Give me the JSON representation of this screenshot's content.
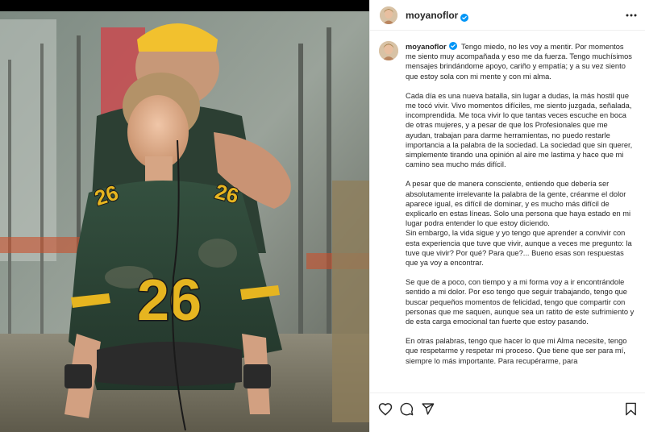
{
  "post": {
    "username": "moyanoflor",
    "verified": true,
    "more_icon": "more-horizontal-icon"
  },
  "photo": {
    "description_icon": "post-photo",
    "jersey_number": "26",
    "sleeve_number": "26"
  },
  "caption": {
    "username": "moyanoflor",
    "paragraphs": [
      "Tengo miedo, no les voy a mentir. Por momentos me siento muy acompañada y eso me da fuerza. Tengo muchísimos mensajes brindándome apoyo, cariño y empatía; y a su vez siento que estoy sola con mi mente y con mi alma.",
      "Cada día es una nueva batalla, sin lugar a dudas, la más hostil que me tocó vivir. Vivo momentos difíciles, me siento juzgada, señalada, incomprendida. Me toca vivir lo que tantas veces escuche en boca de otras mujeres, y a pesar de que los Profesionales que me ayudan, trabajan para darme herramientas, no puedo restarle importancia a la palabra de la sociedad. La sociedad que sin querer, simplemente tirando una opinión al aire me lastima y hace que mi camino sea mucho más difícil.",
      "A pesar que de manera consciente, entiendo que debería ser absolutamente irrelevante la palabra de la gente, créanme el dolor aparece igual, es difícil de dominar, y es mucho más difícil de explicarlo en estas líneas. Solo una persona que haya estado en mi lugar podra entender lo que estoy diciendo.\nSin embargo, la vida sigue y yo tengo que aprender a convivir con esta experiencia que tuve que vivir, aunque a veces me pregunto: la tuve que vivir? Por qué? Para que?... Bueno esas son respuestas que ya voy a encontrar.",
      "Se que de a poco, con tiempo y a mi forma voy a ir encontrándole sentido a mi dolor. Por eso tengo que seguir trabajando, tengo que buscar pequeños momentos de felicidad, tengo que compartir con personas que me saquen, aunque sea un ratito de este sufrimiento y de esta carga emocional tan fuerte que estoy pasando.",
      "En otras palabras, tengo que hacer lo que mi Alma necesite, tengo que respetarme y respetar mi proceso. Que tiene que ser para mí, siempre lo más importante. Para recupérarme, para"
    ]
  },
  "actions": {
    "like_icon": "heart-icon",
    "comment_icon": "comment-icon",
    "share_icon": "send-icon",
    "save_icon": "bookmark-icon"
  },
  "colors": {
    "verified_blue": "#0095f6",
    "jersey_green": "#2f4a3a",
    "jersey_yellow": "#e6b520",
    "helmet_yellow": "#f2c12e",
    "divider": "#efefef"
  }
}
